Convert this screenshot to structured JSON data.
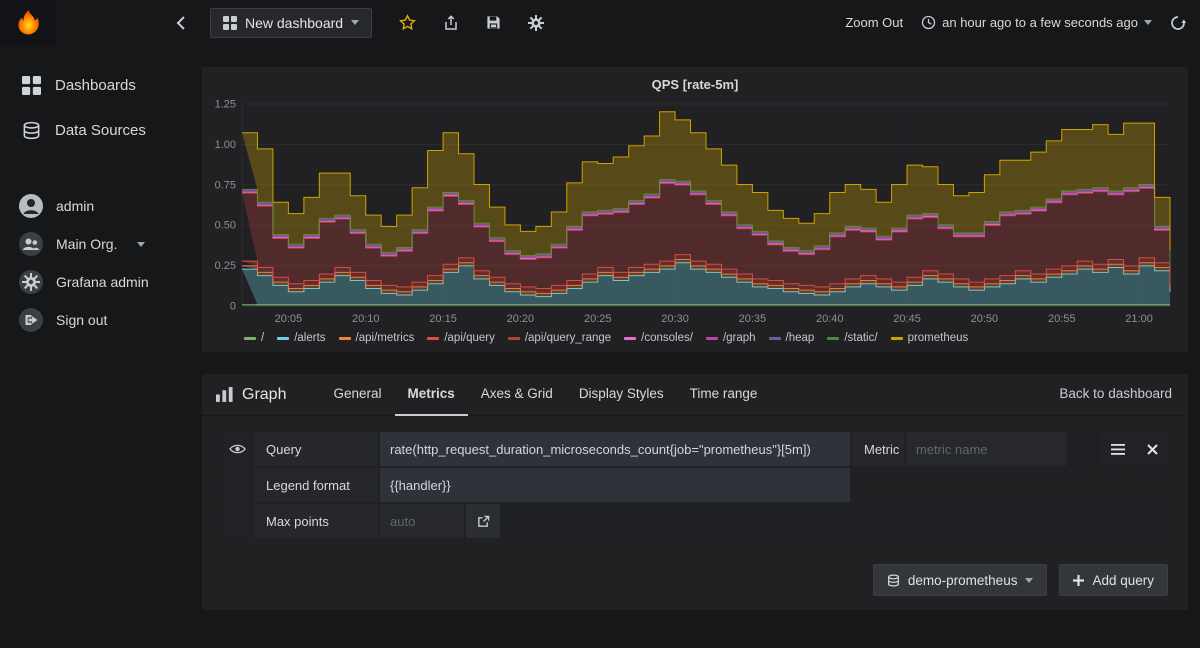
{
  "navbar": {
    "dashboard_picker": "New dashboard",
    "zoom_out": "Zoom Out",
    "time_range": "an hour ago to a few seconds ago"
  },
  "sidebar": {
    "items": [
      {
        "label": "Dashboards"
      },
      {
        "label": "Data Sources"
      }
    ],
    "user": [
      {
        "label": "admin"
      },
      {
        "label": "Main Org."
      },
      {
        "label": "Grafana admin"
      },
      {
        "label": "Sign out"
      }
    ]
  },
  "panel": {
    "title": "QPS [rate-5m]"
  },
  "editor": {
    "panel_type": "Graph",
    "tabs": [
      "General",
      "Metrics",
      "Axes & Grid",
      "Display Styles",
      "Time range"
    ],
    "active_tab": "Metrics",
    "back_link": "Back to dashboard",
    "query_row": {
      "label": "Query",
      "value": "rate(http_request_duration_microseconds_count{job=\"prometheus\"}[5m])",
      "metric_label": "Metric",
      "metric_placeholder": "metric name"
    },
    "legend_row": {
      "label": "Legend format",
      "value": "{{handler}}"
    },
    "max_points_row": {
      "label": "Max points",
      "placeholder": "auto"
    },
    "datasource_button": "demo-prometheus",
    "add_query_button": "Add query"
  },
  "chart_data": {
    "type": "area",
    "stacked": true,
    "title": "QPS [rate-5m]",
    "x_range": [
      0,
      60
    ],
    "n_points": 61,
    "x_start_label": "20:02",
    "x_ticks": [
      "20:05",
      "20:10",
      "20:15",
      "20:20",
      "20:25",
      "20:30",
      "20:35",
      "20:40",
      "20:45",
      "20:50",
      "20:55",
      "21:00"
    ],
    "x_tick_minutes": [
      3,
      8,
      13,
      18,
      23,
      28,
      33,
      38,
      43,
      48,
      53,
      58
    ],
    "ylim": [
      0,
      1.25
    ],
    "y_ticks": [
      0,
      0.25,
      0.5,
      0.75,
      1.0,
      1.25
    ],
    "y_tick_labels": [
      "0",
      "0.25",
      "0.50",
      "0.75",
      "1.00",
      "1.25"
    ],
    "legend_position": "bottom",
    "grid": true,
    "series": [
      {
        "name": "/",
        "color": "#7EB26D",
        "values": 0.008
      },
      {
        "name": "/alerts",
        "color": "#6ED0E0",
        "values": [
          0.22,
          0.18,
          0.12,
          0.08,
          0.1,
          0.14,
          0.18,
          0.15,
          0.1,
          0.07,
          0.06,
          0.09,
          0.13,
          0.2,
          0.24,
          0.16,
          0.12,
          0.08,
          0.06,
          0.05,
          0.07,
          0.1,
          0.14,
          0.18,
          0.15,
          0.18,
          0.2,
          0.22,
          0.26,
          0.22,
          0.2,
          0.17,
          0.14,
          0.11,
          0.1,
          0.08,
          0.07,
          0.06,
          0.08,
          0.11,
          0.13,
          0.11,
          0.09,
          0.12,
          0.16,
          0.14,
          0.11,
          0.09,
          0.11,
          0.13,
          0.16,
          0.14,
          0.17,
          0.19,
          0.22,
          0.2,
          0.23,
          0.19,
          0.24,
          0.21,
          0.08
        ]
      },
      {
        "name": "/api/metrics",
        "color": "#EF843C",
        "values": 0.02
      },
      {
        "name": "/api/query",
        "color": "#E24D42",
        "values": 0.03
      },
      {
        "name": "/api/query_range",
        "color": "#B7403B",
        "values": [
          0.42,
          0.38,
          0.24,
          0.22,
          0.26,
          0.32,
          0.3,
          0.24,
          0.2,
          0.18,
          0.22,
          0.3,
          0.4,
          0.42,
          0.33,
          0.27,
          0.22,
          0.18,
          0.17,
          0.19,
          0.23,
          0.31,
          0.36,
          0.33,
          0.37,
          0.39,
          0.41,
          0.48,
          0.43,
          0.41,
          0.37,
          0.33,
          0.28,
          0.27,
          0.22,
          0.2,
          0.19,
          0.23,
          0.29,
          0.3,
          0.27,
          0.24,
          0.31,
          0.36,
          0.33,
          0.28,
          0.26,
          0.28,
          0.33,
          0.37,
          0.35,
          0.39,
          0.41,
          0.44,
          0.42,
          0.45,
          0.4,
          0.46,
          0.43,
          0.2,
          0.1
        ]
      },
      {
        "name": "/consoles/",
        "color": "#E36FC7",
        "values": 0.006
      },
      {
        "name": "/graph",
        "color": "#BA43A9",
        "values": 0.006
      },
      {
        "name": "/heap",
        "color": "#705DA0",
        "values": 0.006
      },
      {
        "name": "/static/",
        "color": "#508642",
        "values": 0.006
      },
      {
        "name": "prometheus",
        "color": "#CCA300",
        "values": [
          0.35,
          0.33,
          0.2,
          0.19,
          0.23,
          0.28,
          0.26,
          0.21,
          0.18,
          0.16,
          0.2,
          0.26,
          0.35,
          0.37,
          0.29,
          0.24,
          0.19,
          0.16,
          0.15,
          0.17,
          0.2,
          0.27,
          0.31,
          0.29,
          0.32,
          0.34,
          0.36,
          0.42,
          0.38,
          0.36,
          0.32,
          0.29,
          0.25,
          0.24,
          0.19,
          0.18,
          0.17,
          0.2,
          0.25,
          0.26,
          0.24,
          0.21,
          0.27,
          0.31,
          0.29,
          0.25,
          0.23,
          0.25,
          0.29,
          0.32,
          0.31,
          0.34,
          0.36,
          0.38,
          0.37,
          0.39,
          0.35,
          0.4,
          0.38,
          0.18,
          0.08
        ]
      }
    ]
  }
}
